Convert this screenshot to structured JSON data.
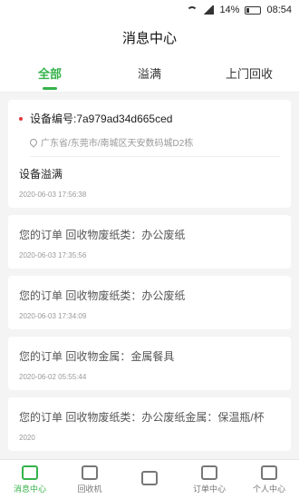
{
  "status": {
    "time": "08:54",
    "battery": "14%"
  },
  "header": {
    "title": "消息中心"
  },
  "tabs": [
    "全部",
    "溢满",
    "上门回收"
  ],
  "device_card": {
    "title": "设备编号:7a979ad34d665ced",
    "address": "广东省/东莞市/南城区天安数码城D2栋",
    "message": "设备溢满",
    "time": "2020-06-03 17:56:38"
  },
  "orders": [
    {
      "message": "您的订单 回收物废纸类：办公废纸",
      "time": "2020-06-03 17:35:56"
    },
    {
      "message": "您的订单 回收物废纸类：办公废纸",
      "time": "2020-06-03 17:34:09"
    },
    {
      "message": "您的订单 回收物金属：金属餐具",
      "time": "2020-06-02 05:55:44"
    },
    {
      "message": "您的订单 回收物废纸类：办公废纸金属：保温瓶/杯",
      "time": "2020"
    }
  ],
  "tabbar": [
    "消息中心",
    "回收机",
    "",
    "订单中心",
    "个人中心"
  ]
}
